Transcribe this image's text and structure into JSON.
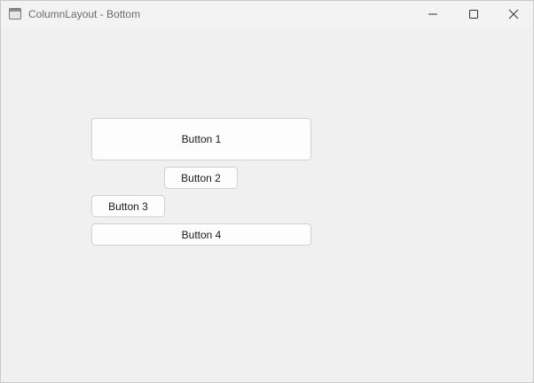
{
  "window": {
    "title": "ColumnLayout - Bottom",
    "icon": "window-app-icon",
    "controls": {
      "minimize": "minimize-icon",
      "maximize": "maximize-icon",
      "close": "close-icon"
    }
  },
  "buttons": {
    "button1": "Button 1",
    "button2": "Button 2",
    "button3": "Button 3",
    "button4": "Button 4"
  }
}
